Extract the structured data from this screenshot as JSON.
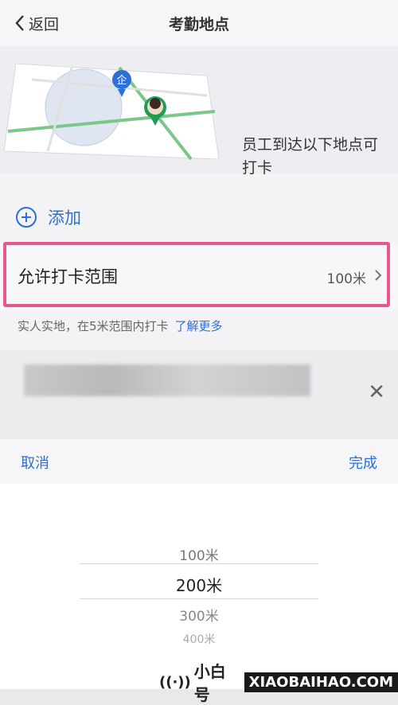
{
  "nav": {
    "back_label": "返回",
    "title": "考勤地点"
  },
  "banner": {
    "text": "员工到达以下地点可打卡",
    "map_badge": "企"
  },
  "add": {
    "label": "添加"
  },
  "range": {
    "label": "允许打卡范围",
    "value": "100米"
  },
  "hint": {
    "text": "实人实地，在5米范围内打卡",
    "link": "了解更多"
  },
  "picker": {
    "cancel": "取消",
    "done": "完成",
    "options": [
      "100米",
      "200米",
      "300米",
      "400米"
    ],
    "selected": "200米"
  },
  "watermark": {
    "brand": "小白号",
    "site": "XIAOBAIHAO.COM"
  },
  "colors": {
    "accent": "#2c6fd6",
    "highlight": "#e8578e"
  }
}
